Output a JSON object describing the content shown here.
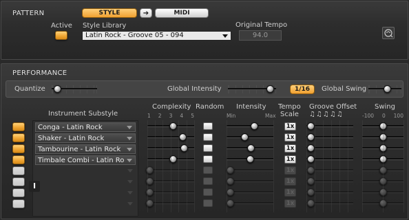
{
  "pattern": {
    "section_title": "PATTERN",
    "style_button": "STYLE",
    "arrow_glyph": "➔",
    "midi_button": "MIDI",
    "active_label": "Active",
    "style_library_label": "Style Library",
    "style_library_value": "Latin Rock - Groove 05 - 094",
    "original_tempo_label": "Original Tempo",
    "original_tempo_value": "94.0",
    "export_icon": "midi-export-icon"
  },
  "performance": {
    "section_title": "PERFORMANCE",
    "quantize_label": "Quantize",
    "global_intensity_label": "Global Intensity",
    "quantize_value_button": "1/16",
    "global_swing_label": "Global Swing",
    "quantize_level": 0.05,
    "global_intensity_level": 0.95,
    "global_swing_level": 0.6
  },
  "table": {
    "instrument_substyle_header": "Instrument Substyle",
    "complexity_header": "Complexity",
    "complexity_ticks": [
      "1",
      "2",
      "3",
      "4",
      "5"
    ],
    "random_header": "Random",
    "intensity_header": "Intensity",
    "intensity_min": "Min",
    "intensity_max": "Max",
    "tempo_scale_header_1": "Tempo",
    "tempo_scale_header_2": "Scale",
    "groove_offset_header": "Groove Offset",
    "groove_offset_notes": "♫♫♫♫♫",
    "swing_header": "Swing",
    "swing_ticks": [
      "-100",
      "0",
      "100"
    ],
    "cursor_glyph": "Ι",
    "rows": [
      {
        "name": "Conga - Latin Rock",
        "active": true,
        "tempo_scale": "1x"
      },
      {
        "name": "Shaker - Latin Rock",
        "active": true,
        "tempo_scale": "1x"
      },
      {
        "name": "Tambourine - Latin Rock",
        "active": true,
        "tempo_scale": "1x"
      },
      {
        "name": "Timbale Combi - Latin Ro",
        "active": true,
        "tempo_scale": "1x"
      },
      {
        "name": "",
        "active": false,
        "tempo_scale": "1x"
      },
      {
        "name": "",
        "active": false,
        "tempo_scale": "1x"
      },
      {
        "name": "",
        "active": false,
        "tempo_scale": "1x"
      },
      {
        "name": "",
        "active": false,
        "tempo_scale": "1x"
      }
    ]
  },
  "colors": {
    "accent_orange": "#f0a836",
    "panel_bg": "#2d2d2d",
    "text": "#d8d8d8"
  }
}
